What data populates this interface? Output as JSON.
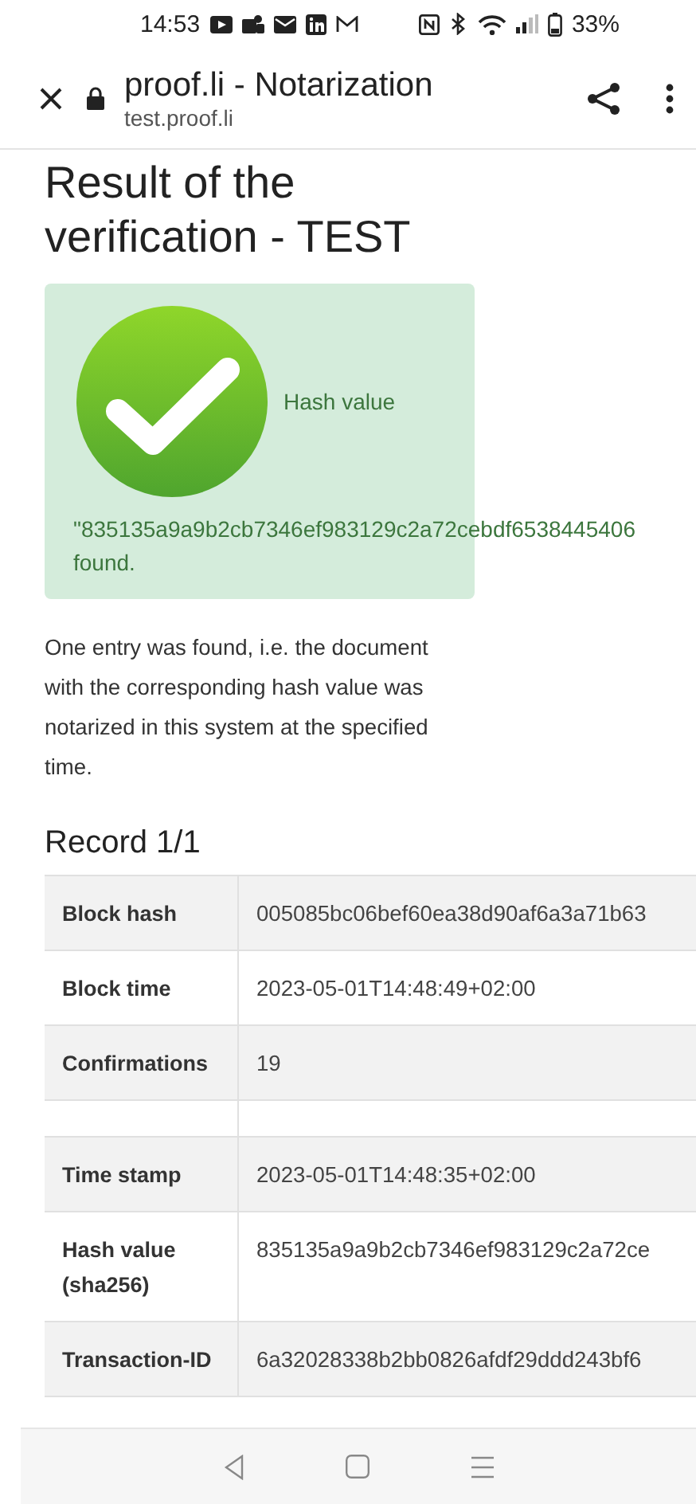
{
  "status_bar": {
    "time": "14:53",
    "battery": "33%"
  },
  "browser": {
    "title": "proof.li - Notarization",
    "url": "test.proof.li"
  },
  "heading": "Result of the verification - TEST",
  "result_card": {
    "label": "Hash value",
    "hash": "\"835135a9a9b2cb7346ef983129c2a72cebdf6538445406",
    "status": "found."
  },
  "description": "One entry was found, i.e. the document with the corresponding hash value was notarized in this system at the specified time.",
  "record_title": "Record 1/1",
  "table": {
    "rows": [
      {
        "kind": "data",
        "label": "Block hash",
        "value": "005085bc06bef60ea38d90af6a3a71b63"
      },
      {
        "kind": "data",
        "label": "Block time",
        "value": "2023-05-01T14:48:49+02:00"
      },
      {
        "kind": "data",
        "label": "Confirmations",
        "value": "19"
      },
      {
        "kind": "spacer"
      },
      {
        "kind": "data",
        "label": "Time stamp",
        "value": "2023-05-01T14:48:35+02:00"
      },
      {
        "kind": "data",
        "label": "Hash value (sha256)",
        "value": "835135a9a9b2cb7346ef983129c2a72ce"
      },
      {
        "kind": "data",
        "label": "Transaction-ID",
        "value": "6a32028338b2bb0826afdf29ddd243bf6"
      }
    ]
  }
}
